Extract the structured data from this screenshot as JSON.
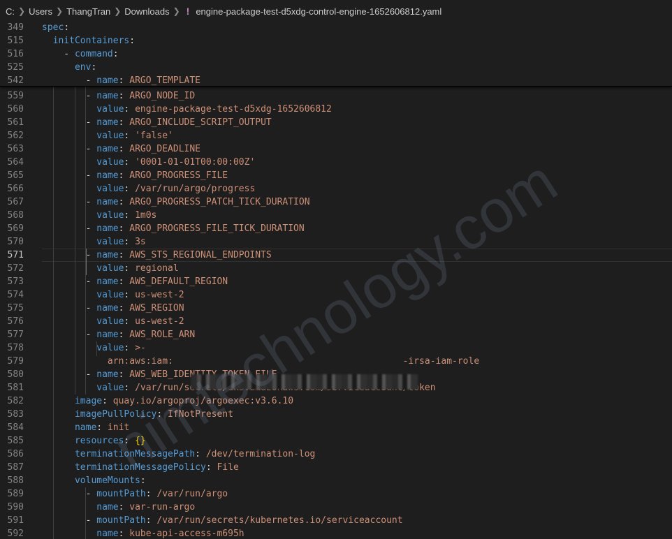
{
  "breadcrumb": {
    "items": [
      "C:",
      "Users",
      "ThangTran",
      "Downloads"
    ],
    "file_icon": "!",
    "file_name": "engine-package-test-d5xdg-control-engine-1652606812.yaml"
  },
  "sticky_lines": [
    {
      "n": "349",
      "tokens": [
        {
          "c": "k",
          "t": "spec"
        },
        {
          "c": "p",
          "t": ":"
        }
      ]
    },
    {
      "n": "515",
      "tokens": [
        {
          "c": "p",
          "t": "  "
        },
        {
          "c": "k",
          "t": "initContainers"
        },
        {
          "c": "p",
          "t": ":"
        }
      ]
    },
    {
      "n": "516",
      "tokens": [
        {
          "c": "p",
          "t": "    - "
        },
        {
          "c": "k",
          "t": "command"
        },
        {
          "c": "p",
          "t": ":"
        }
      ]
    },
    {
      "n": "525",
      "tokens": [
        {
          "c": "p",
          "t": "      "
        },
        {
          "c": "k",
          "t": "env"
        },
        {
          "c": "p",
          "t": ":"
        }
      ]
    },
    {
      "n": "542",
      "tokens": [
        {
          "c": "p",
          "t": "        - "
        },
        {
          "c": "k",
          "t": "name"
        },
        {
          "c": "p",
          "t": ": "
        },
        {
          "c": "s",
          "t": "ARGO_TEMPLATE"
        }
      ]
    }
  ],
  "lines": [
    {
      "n": "559",
      "tokens": [
        {
          "c": "p",
          "t": "        - "
        },
        {
          "c": "k",
          "t": "name"
        },
        {
          "c": "p",
          "t": ": "
        },
        {
          "c": "s",
          "t": "ARGO_NODE_ID"
        }
      ]
    },
    {
      "n": "560",
      "tokens": [
        {
          "c": "p",
          "t": "          "
        },
        {
          "c": "k",
          "t": "value"
        },
        {
          "c": "p",
          "t": ": "
        },
        {
          "c": "s",
          "t": "engine-package-test-d5xdg-1652606812"
        }
      ]
    },
    {
      "n": "561",
      "tokens": [
        {
          "c": "p",
          "t": "        - "
        },
        {
          "c": "k",
          "t": "name"
        },
        {
          "c": "p",
          "t": ": "
        },
        {
          "c": "s",
          "t": "ARGO_INCLUDE_SCRIPT_OUTPUT"
        }
      ]
    },
    {
      "n": "562",
      "tokens": [
        {
          "c": "p",
          "t": "          "
        },
        {
          "c": "k",
          "t": "value"
        },
        {
          "c": "p",
          "t": ": "
        },
        {
          "c": "s",
          "t": "'false'"
        }
      ]
    },
    {
      "n": "563",
      "tokens": [
        {
          "c": "p",
          "t": "        - "
        },
        {
          "c": "k",
          "t": "name"
        },
        {
          "c": "p",
          "t": ": "
        },
        {
          "c": "s",
          "t": "ARGO_DEADLINE"
        }
      ]
    },
    {
      "n": "564",
      "tokens": [
        {
          "c": "p",
          "t": "          "
        },
        {
          "c": "k",
          "t": "value"
        },
        {
          "c": "p",
          "t": ": "
        },
        {
          "c": "s",
          "t": "'0001-01-01T00:00:00Z'"
        }
      ]
    },
    {
      "n": "565",
      "tokens": [
        {
          "c": "p",
          "t": "        - "
        },
        {
          "c": "k",
          "t": "name"
        },
        {
          "c": "p",
          "t": ": "
        },
        {
          "c": "s",
          "t": "ARGO_PROGRESS_FILE"
        }
      ]
    },
    {
      "n": "566",
      "tokens": [
        {
          "c": "p",
          "t": "          "
        },
        {
          "c": "k",
          "t": "value"
        },
        {
          "c": "p",
          "t": ": "
        },
        {
          "c": "s",
          "t": "/var/run/argo/progress"
        }
      ]
    },
    {
      "n": "567",
      "tokens": [
        {
          "c": "p",
          "t": "        - "
        },
        {
          "c": "k",
          "t": "name"
        },
        {
          "c": "p",
          "t": ": "
        },
        {
          "c": "s",
          "t": "ARGO_PROGRESS_PATCH_TICK_DURATION"
        }
      ]
    },
    {
      "n": "568",
      "tokens": [
        {
          "c": "p",
          "t": "          "
        },
        {
          "c": "k",
          "t": "value"
        },
        {
          "c": "p",
          "t": ": "
        },
        {
          "c": "s",
          "t": "1m0s"
        }
      ]
    },
    {
      "n": "569",
      "tokens": [
        {
          "c": "p",
          "t": "        - "
        },
        {
          "c": "k",
          "t": "name"
        },
        {
          "c": "p",
          "t": ": "
        },
        {
          "c": "s",
          "t": "ARGO_PROGRESS_FILE_TICK_DURATION"
        }
      ]
    },
    {
      "n": "570",
      "tokens": [
        {
          "c": "p",
          "t": "          "
        },
        {
          "c": "k",
          "t": "value"
        },
        {
          "c": "p",
          "t": ": "
        },
        {
          "c": "s",
          "t": "3s"
        }
      ]
    },
    {
      "n": "571",
      "current": true,
      "tokens": [
        {
          "c": "p",
          "t": "        - "
        },
        {
          "c": "k",
          "t": "name"
        },
        {
          "c": "p",
          "t": ": "
        },
        {
          "c": "s",
          "t": "AWS_STS_REGIONAL_ENDPOINTS"
        }
      ]
    },
    {
      "n": "572",
      "tokens": [
        {
          "c": "p",
          "t": "          "
        },
        {
          "c": "k",
          "t": "value"
        },
        {
          "c": "p",
          "t": ": "
        },
        {
          "c": "s",
          "t": "regional"
        }
      ]
    },
    {
      "n": "573",
      "tokens": [
        {
          "c": "p",
          "t": "        - "
        },
        {
          "c": "k",
          "t": "name"
        },
        {
          "c": "p",
          "t": ": "
        },
        {
          "c": "s",
          "t": "AWS_DEFAULT_REGION"
        }
      ]
    },
    {
      "n": "574",
      "tokens": [
        {
          "c": "p",
          "t": "          "
        },
        {
          "c": "k",
          "t": "value"
        },
        {
          "c": "p",
          "t": ": "
        },
        {
          "c": "s",
          "t": "us-west-2"
        }
      ]
    },
    {
      "n": "575",
      "tokens": [
        {
          "c": "p",
          "t": "        - "
        },
        {
          "c": "k",
          "t": "name"
        },
        {
          "c": "p",
          "t": ": "
        },
        {
          "c": "s",
          "t": "AWS_REGION"
        }
      ]
    },
    {
      "n": "576",
      "tokens": [
        {
          "c": "p",
          "t": "          "
        },
        {
          "c": "k",
          "t": "value"
        },
        {
          "c": "p",
          "t": ": "
        },
        {
          "c": "s",
          "t": "us-west-2"
        }
      ]
    },
    {
      "n": "577",
      "tokens": [
        {
          "c": "p",
          "t": "        - "
        },
        {
          "c": "k",
          "t": "name"
        },
        {
          "c": "p",
          "t": ": "
        },
        {
          "c": "s",
          "t": "AWS_ROLE_ARN"
        }
      ]
    },
    {
      "n": "578",
      "tokens": [
        {
          "c": "p",
          "t": "          "
        },
        {
          "c": "k",
          "t": "value"
        },
        {
          "c": "p",
          "t": ": "
        },
        {
          "c": "s",
          "t": ">-"
        }
      ]
    },
    {
      "n": "579",
      "tokens": [
        {
          "c": "p",
          "t": "            "
        },
        {
          "c": "s",
          "t": "arn:aws:iam:"
        },
        {
          "c": "p",
          "t": "                                          "
        },
        {
          "c": "s",
          "t": "-irsa-iam-role"
        }
      ]
    },
    {
      "n": "580",
      "tokens": [
        {
          "c": "p",
          "t": "        - "
        },
        {
          "c": "k",
          "t": "name"
        },
        {
          "c": "p",
          "t": ": "
        },
        {
          "c": "s",
          "t": "AWS_WEB_IDENTITY_TOKEN_FILE"
        }
      ]
    },
    {
      "n": "581",
      "tokens": [
        {
          "c": "p",
          "t": "          "
        },
        {
          "c": "k",
          "t": "value"
        },
        {
          "c": "p",
          "t": ": "
        },
        {
          "c": "s",
          "t": "/var/run/secrets/eks.amazonaws.com/serviceaccount/token"
        }
      ]
    },
    {
      "n": "582",
      "tokens": [
        {
          "c": "p",
          "t": "      "
        },
        {
          "c": "k",
          "t": "image"
        },
        {
          "c": "p",
          "t": ": "
        },
        {
          "c": "s",
          "t": "quay.io/argoproj/argoexec:v3.6.10"
        }
      ]
    },
    {
      "n": "583",
      "tokens": [
        {
          "c": "p",
          "t": "      "
        },
        {
          "c": "k",
          "t": "imagePullPolicy"
        },
        {
          "c": "p",
          "t": ": "
        },
        {
          "c": "s",
          "t": "IfNotPresent"
        }
      ]
    },
    {
      "n": "584",
      "tokens": [
        {
          "c": "p",
          "t": "      "
        },
        {
          "c": "k",
          "t": "name"
        },
        {
          "c": "p",
          "t": ": "
        },
        {
          "c": "s",
          "t": "init"
        }
      ]
    },
    {
      "n": "585",
      "tokens": [
        {
          "c": "p",
          "t": "      "
        },
        {
          "c": "k",
          "t": "resources"
        },
        {
          "c": "p",
          "t": ": "
        },
        {
          "c": "b",
          "t": "{}"
        }
      ]
    },
    {
      "n": "586",
      "tokens": [
        {
          "c": "p",
          "t": "      "
        },
        {
          "c": "k",
          "t": "terminationMessagePath"
        },
        {
          "c": "p",
          "t": ": "
        },
        {
          "c": "s",
          "t": "/dev/termination-log"
        }
      ]
    },
    {
      "n": "587",
      "tokens": [
        {
          "c": "p",
          "t": "      "
        },
        {
          "c": "k",
          "t": "terminationMessagePolicy"
        },
        {
          "c": "p",
          "t": ": "
        },
        {
          "c": "s",
          "t": "File"
        }
      ]
    },
    {
      "n": "588",
      "tokens": [
        {
          "c": "p",
          "t": "      "
        },
        {
          "c": "k",
          "t": "volumeMounts"
        },
        {
          "c": "p",
          "t": ":"
        }
      ]
    },
    {
      "n": "589",
      "tokens": [
        {
          "c": "p",
          "t": "        - "
        },
        {
          "c": "k",
          "t": "mountPath"
        },
        {
          "c": "p",
          "t": ": "
        },
        {
          "c": "s",
          "t": "/var/run/argo"
        }
      ]
    },
    {
      "n": "590",
      "tokens": [
        {
          "c": "p",
          "t": "          "
        },
        {
          "c": "k",
          "t": "name"
        },
        {
          "c": "p",
          "t": ": "
        },
        {
          "c": "s",
          "t": "var-run-argo"
        }
      ]
    },
    {
      "n": "591",
      "tokens": [
        {
          "c": "p",
          "t": "        - "
        },
        {
          "c": "k",
          "t": "mountPath"
        },
        {
          "c": "p",
          "t": ": "
        },
        {
          "c": "s",
          "t": "/var/run/secrets/kubernetes.io/serviceaccount"
        }
      ]
    },
    {
      "n": "592",
      "tokens": [
        {
          "c": "p",
          "t": "          "
        },
        {
          "c": "k",
          "t": "name"
        },
        {
          "c": "p",
          "t": ": "
        },
        {
          "c": "s",
          "t": "kube-api-access-m695h"
        }
      ]
    }
  ],
  "watermark": "nimtechnology.com",
  "colors": {
    "background": "#1e1e1e",
    "key": "#569cd6",
    "string": "#ce9178",
    "punctuation": "#d4d4d4",
    "bracket": "#ffd700",
    "line_number": "#858585",
    "yaml_icon": "#c586c0"
  }
}
